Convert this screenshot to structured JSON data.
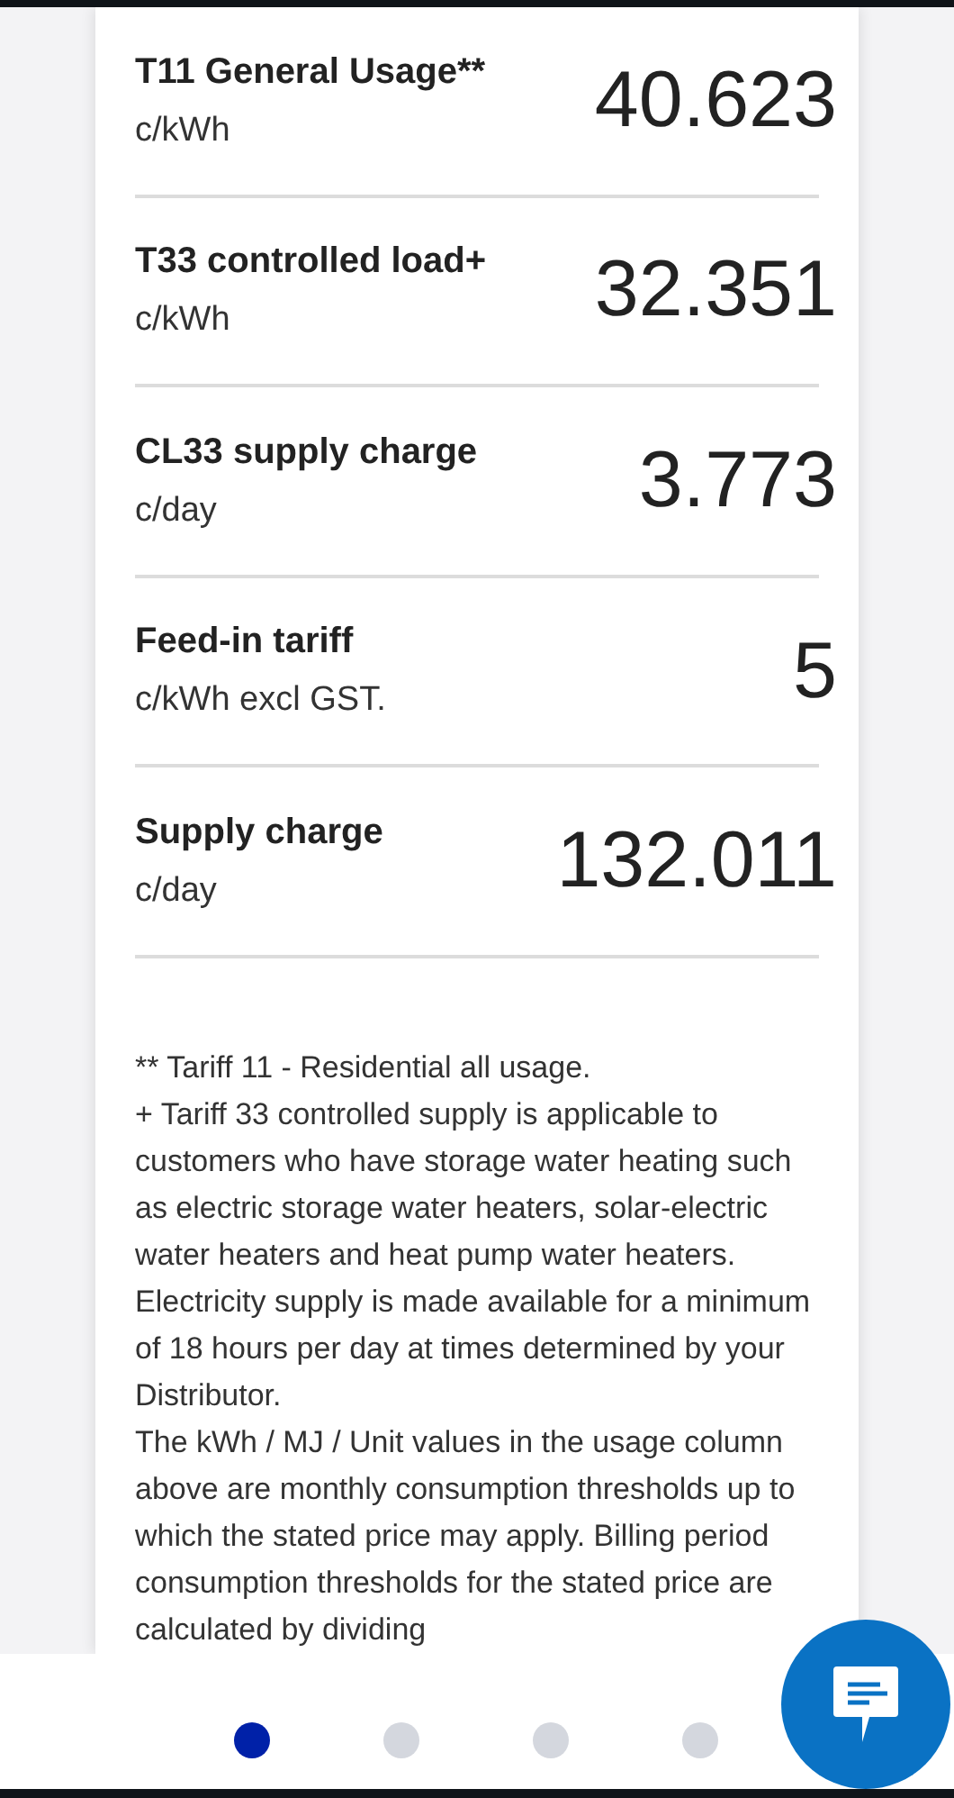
{
  "rates": [
    {
      "label": "T11 General Usage**",
      "unit": "c/kWh",
      "value": "40.623"
    },
    {
      "label": "T33 controlled load+",
      "unit": "c/kWh",
      "value": "32.351"
    },
    {
      "label": "CL33 supply charge",
      "unit": "c/day",
      "value": "3.773"
    },
    {
      "label": "Feed-in tariff",
      "unit": "c/kWh excl GST.",
      "value": "5"
    },
    {
      "label": "Supply charge",
      "unit": "c/day",
      "value": "132.011"
    }
  ],
  "notes": [
    "** Tariff 11 - Residential all usage.",
    "+ Tariff 33 controlled supply is applicable to customers who have storage water heating such as electric storage water heaters, solar-electric water heaters and heat pump water heaters. Electricity supply is made available for a minimum of 18 hours per day at times determined by your Distributor.",
    "The kWh / MJ / Unit values in the usage column above are monthly consumption thresholds up to which the stated price may apply. Billing period consumption thresholds for the stated price are calculated by dividing"
  ],
  "pager": [
    {
      "selected": true
    },
    {
      "selected": false
    },
    {
      "selected": false
    },
    {
      "selected": false
    }
  ]
}
